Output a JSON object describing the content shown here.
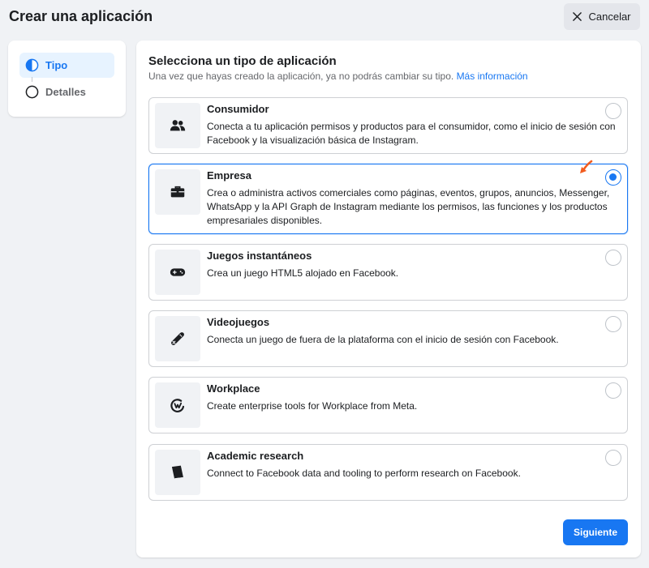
{
  "header": {
    "title": "Crear una aplicación",
    "cancel_label": "Cancelar"
  },
  "stepper": {
    "steps": [
      {
        "label": "Tipo",
        "state": "active"
      },
      {
        "label": "Detalles",
        "state": "pending"
      }
    ]
  },
  "main": {
    "title": "Selecciona un tipo de aplicación",
    "subtitle": "Una vez que hayas creado la aplicación, ya no podrás cambiar su tipo.",
    "more_info_link": "Más información",
    "options": [
      {
        "title": "Consumidor",
        "description": "Conecta a tu aplicación permisos y productos para el consumidor, como el inicio de sesión con Facebook y la visualización básica de Instagram.",
        "icon": "people-icon",
        "selected": false
      },
      {
        "title": "Empresa",
        "description": "Crea o administra activos comerciales como páginas, eventos, grupos, anuncios, Messenger, WhatsApp y la API Graph de Instagram mediante los permisos, las funciones y los productos empresariales disponibles.",
        "icon": "briefcase-icon",
        "selected": true
      },
      {
        "title": "Juegos instantáneos",
        "description": "Crea un juego HTML5 alojado en Facebook.",
        "icon": "gamepad-icon",
        "selected": false
      },
      {
        "title": "Videojuegos",
        "description": "Conecta un juego de fuera de la plataforma con el inicio de sesión con Facebook.",
        "icon": "joystick-icon",
        "selected": false
      },
      {
        "title": "Workplace",
        "description": "Create enterprise tools for Workplace from Meta.",
        "icon": "workplace-logo-icon",
        "selected": false
      },
      {
        "title": "Academic research",
        "description": "Connect to Facebook data and tooling to perform research on Facebook.",
        "icon": "book-icon",
        "selected": false
      }
    ],
    "next_label": "Siguiente"
  },
  "colors": {
    "accent": "#1877f2",
    "background": "#f0f2f5",
    "annotation_arrow": "#f25c1f"
  }
}
